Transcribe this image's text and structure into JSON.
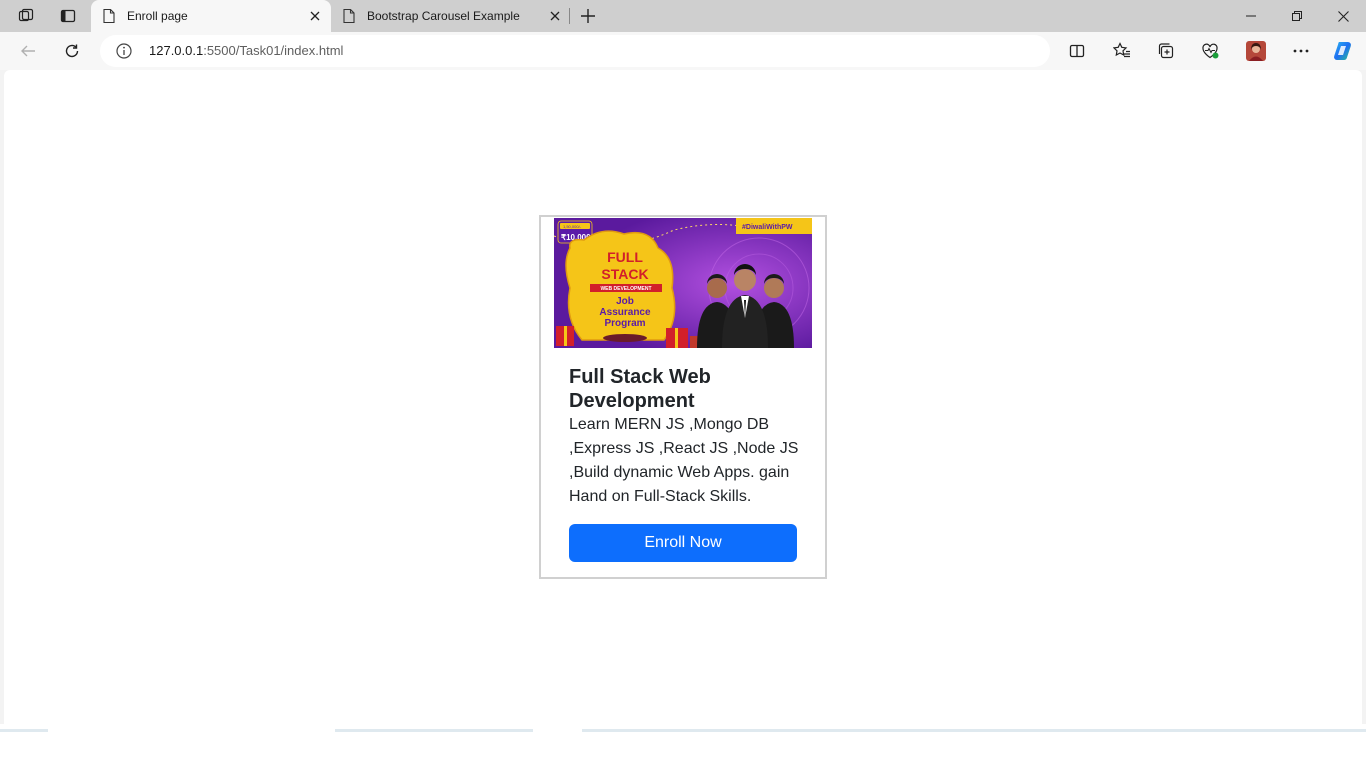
{
  "browser": {
    "tabs": [
      {
        "title": "Enroll page",
        "active": true
      },
      {
        "title": "Bootstrap Carousel Example",
        "active": false
      }
    ],
    "url_host": "127.0.0.1",
    "url_rest": ":5500/Task01/index.html"
  },
  "card": {
    "banner": {
      "badge_price_small": "1,50,000/-",
      "badge_price": "₹10,000/-",
      "hashtag": "#DiwaliWithPW",
      "title_line1": "FULL",
      "title_line2": "STACK",
      "ribbon": "WEB DEVELOPMENT",
      "program_line1": "Job",
      "program_line2": "Assurance",
      "program_line3": "Program"
    },
    "title": "Full Stack Web Development",
    "text": "Learn MERN JS ,Mongo DB ,Express JS ,React JS ,Node JS ,Build dynamic Web Apps. gain Hand on Full-Stack Skills.",
    "button_label": "Enroll Now"
  },
  "colors": {
    "primary": "#0d6efd",
    "banner_purple": "#7a26c1",
    "banner_gold": "#f5c518"
  }
}
